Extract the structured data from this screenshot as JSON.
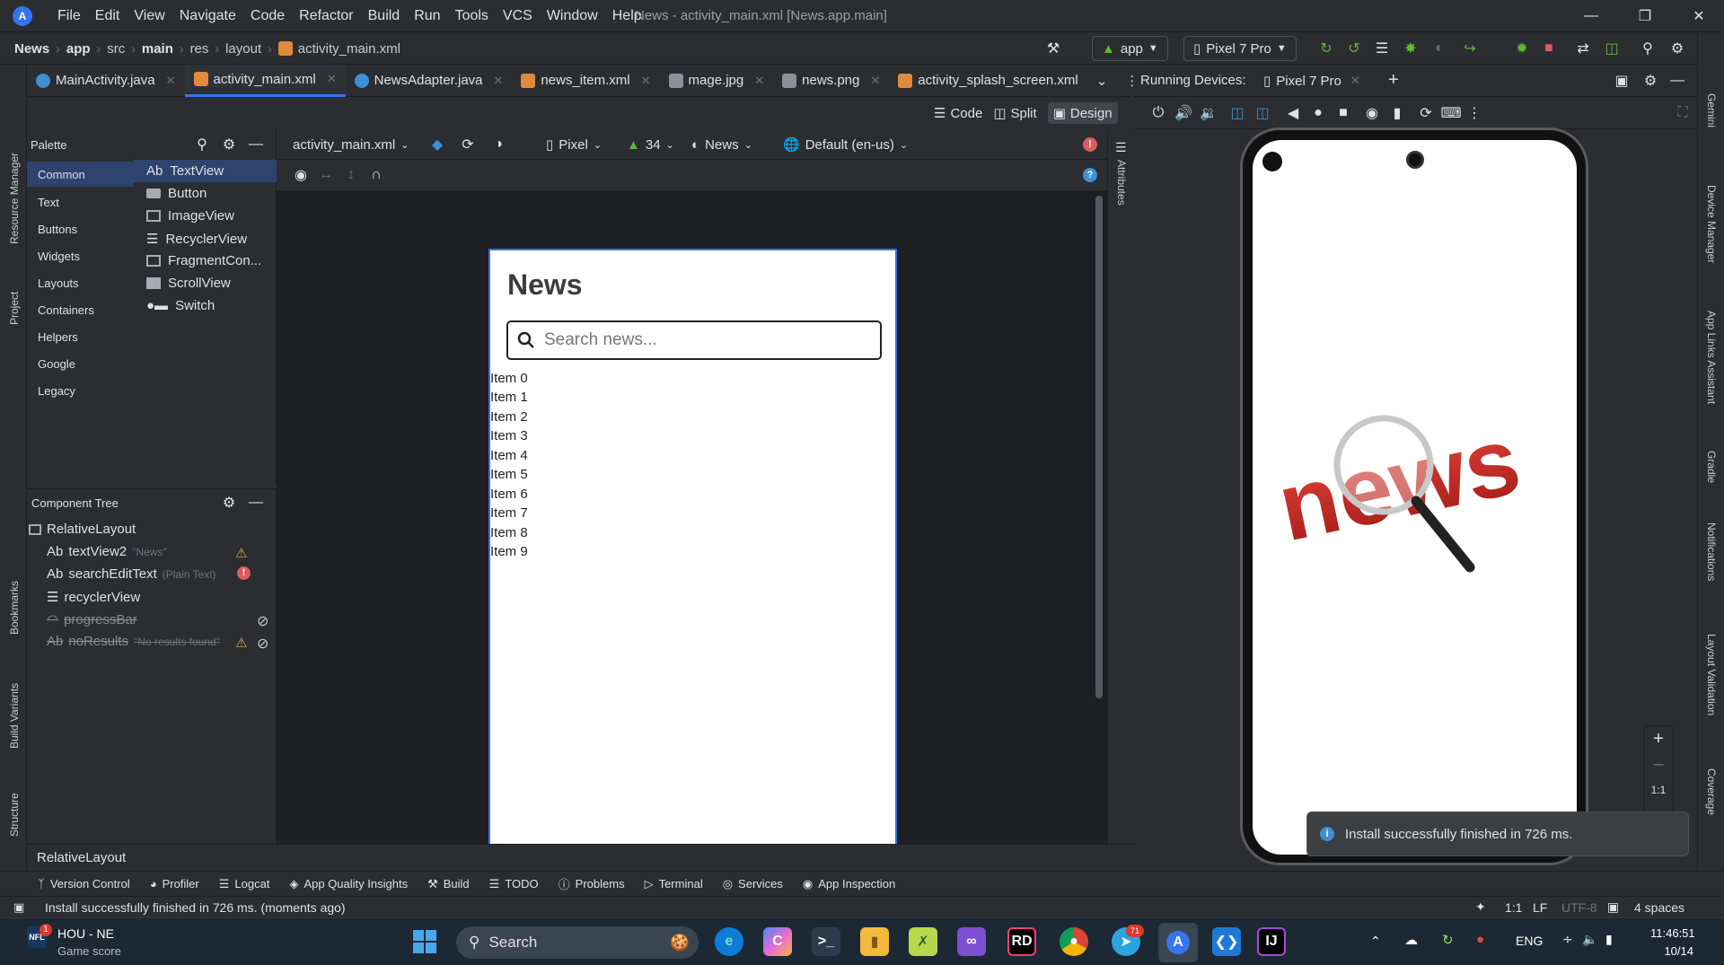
{
  "titlebar": {
    "menu": [
      "File",
      "Edit",
      "View",
      "Navigate",
      "Code",
      "Refactor",
      "Build",
      "Run",
      "Tools",
      "VCS",
      "Window",
      "Help"
    ],
    "window_title": "News - activity_main.xml [News.app.main]"
  },
  "navbar": {
    "crumbs": [
      "News",
      "app",
      "src",
      "main",
      "res",
      "layout"
    ],
    "file": "activity_main.xml",
    "run_config": "app",
    "device": "Pixel 7 Pro"
  },
  "tabs": [
    {
      "label": "MainActivity.java",
      "color": "#3d8fd6"
    },
    {
      "label": "activity_main.xml",
      "color": "#e08b3b"
    },
    {
      "label": "NewsAdapter.java",
      "color": "#3d8fd6"
    },
    {
      "label": "news_item.xml",
      "color": "#e08b3b"
    },
    {
      "label": "mage.jpg",
      "color": "#8c9099"
    },
    {
      "label": "news.png",
      "color": "#8c9099"
    },
    {
      "label": "activity_splash_screen.xml",
      "color": "#e08b3b"
    }
  ],
  "view_modes": {
    "code": "Code",
    "split": "Split",
    "design": "Design"
  },
  "left_stripe": {
    "top": [
      "Resource Manager",
      "Project"
    ],
    "bottom": [
      "Bookmarks",
      "Build Variants",
      "Structure"
    ]
  },
  "right_stripe": [
    "Gemini",
    "Device Manager",
    "App Links Assistant",
    "Gradle",
    "Notifications",
    "Layout Validation",
    "Coverage"
  ],
  "palette": {
    "title": "Palette",
    "categories": [
      "Common",
      "Text",
      "Buttons",
      "Widgets",
      "Layouts",
      "Containers",
      "Helpers",
      "Google",
      "Legacy"
    ],
    "items": [
      {
        "prefix": "Ab",
        "label": "TextView"
      },
      {
        "prefix": "",
        "label": "Button"
      },
      {
        "prefix": "",
        "label": "ImageView"
      },
      {
        "prefix": "",
        "label": "RecyclerView"
      },
      {
        "prefix": "",
        "label": "FragmentCon..."
      },
      {
        "prefix": "",
        "label": "ScrollView"
      },
      {
        "prefix": "",
        "label": "Switch"
      }
    ]
  },
  "component_tree": {
    "title": "Component Tree",
    "root": "RelativeLayout",
    "nodes": [
      {
        "prefix": "Ab",
        "label": "textView2",
        "hint": "\"News\""
      },
      {
        "prefix": "Ab",
        "label": "searchEditText",
        "hint": "(Plain Text)"
      },
      {
        "prefix": "",
        "label": "recyclerView",
        "hint": ""
      },
      {
        "prefix": "",
        "label": "progressBar",
        "hint": ""
      },
      {
        "prefix": "Ab",
        "label": "noResults",
        "hint": "\"No results found\""
      }
    ]
  },
  "design_toolbar": {
    "file": "activity_main.xml",
    "device": "Pixel",
    "api": "34",
    "theme": "News",
    "locale": "Default (en-us)"
  },
  "attributes_label": "Attributes",
  "blueprint": {
    "title": "News",
    "search_placeholder": "Search news...",
    "items": [
      "Item 0",
      "Item 1",
      "Item 2",
      "Item 3",
      "Item 4",
      "Item 5",
      "Item 6",
      "Item 7",
      "Item 8",
      "Item 9"
    ]
  },
  "breadcrumb_bottom": "RelativeLayout",
  "tool_windows": [
    "Version Control",
    "Profiler",
    "Logcat",
    "App Quality Insights",
    "Build",
    "TODO",
    "Problems",
    "Terminal",
    "Services",
    "App Inspection"
  ],
  "status": {
    "message": "Install successfully finished in 726 ms. (moments ago)",
    "zoom": "1:1",
    "line_sep": "LF",
    "encoding": "UTF-8",
    "indent": "4 spaces"
  },
  "running_devices": {
    "label": "Running Devices:",
    "device_tab": "Pixel 7 Pro",
    "toast": "Install successfully finished in 726 ms.",
    "zoom_label": "1:1",
    "splash_text": "news"
  },
  "taskbar": {
    "weather_title": "HOU - NE",
    "weather_sub": "Game score",
    "badge": "1",
    "search": "Search",
    "lang": "ENG",
    "time": "11:46:51",
    "date": "10/14",
    "telegram_badge": "71"
  },
  "colors": {
    "accent": "#3574f0",
    "bg": "#2b2d30",
    "selection": "#2e436e",
    "news_red": "#d0302a"
  }
}
